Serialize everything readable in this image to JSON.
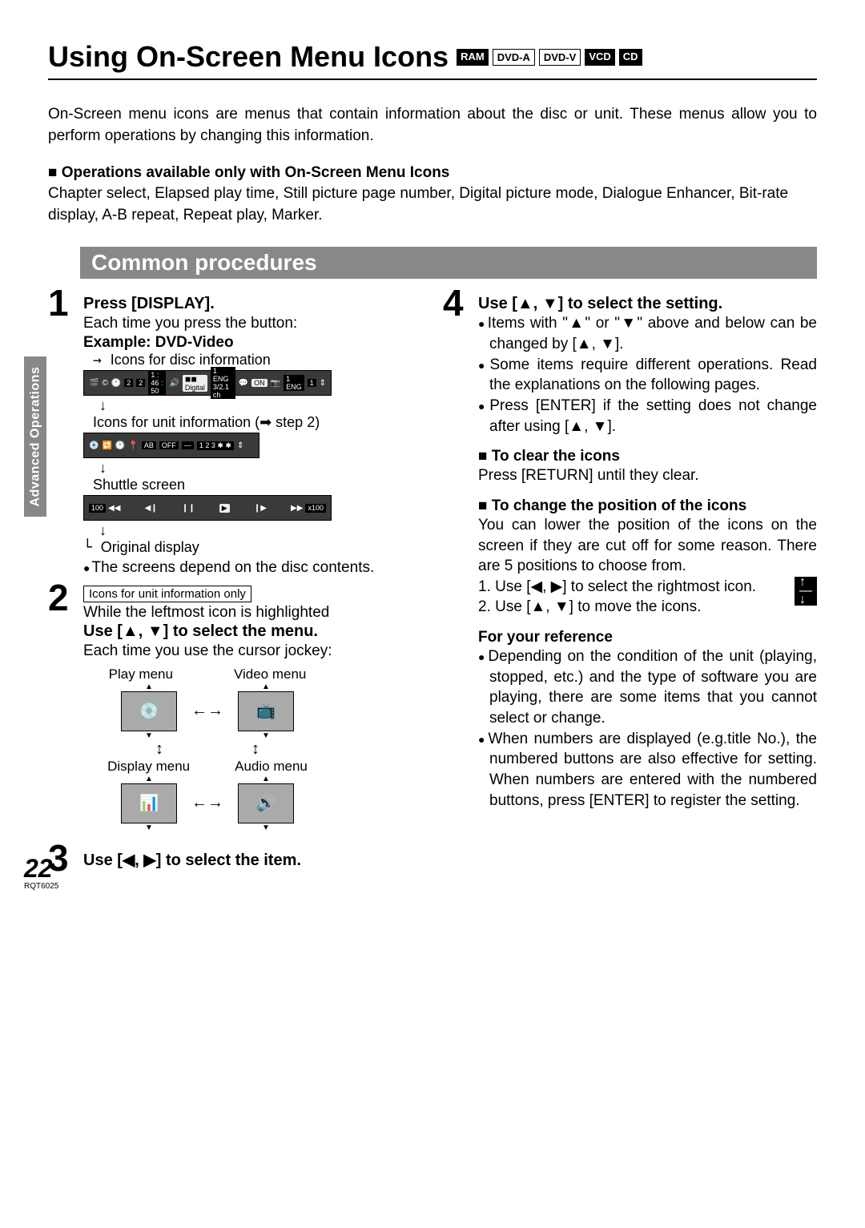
{
  "title": "Using On-Screen Menu Icons",
  "badges": [
    "RAM",
    "DVD-A",
    "DVD-V",
    "VCD",
    "CD"
  ],
  "sidetab": "Advanced Operations",
  "intro": "On-Screen menu icons are menus that contain information about the disc or unit. These menus allow you to perform operations by changing this information.",
  "ops_head": "Operations available only with On-Screen Menu Icons",
  "ops_list": "Chapter select, Elapsed play time, Still picture page number, Digital picture mode, Dialogue Enhancer, Bit-rate display, A-B repeat, Repeat play, Marker.",
  "section_bar": "Common procedures",
  "step1": {
    "num": "1",
    "title": "Press [DISPLAY].",
    "line1": "Each time you press the button:",
    "example": "Example:  DVD-Video",
    "l_disc": "Icons for disc information",
    "l_unit": "Icons for unit information (➡ step 2)",
    "l_shuttle": "Shuttle screen",
    "l_orig": "Original display",
    "bullet": "The screens depend on the disc contents.",
    "osd1": {
      "a": "2",
      "b": "2",
      "c": "1 : 46 : 50",
      "d": "Digital",
      "e": "1 ENG 3/2.1 ch",
      "f": "ON",
      "g": "1 ENG",
      "h": "1"
    },
    "osd2": {
      "a": "AB",
      "b": "OFF",
      "c": "---",
      "d": "1 2 3 ✱ ✱"
    },
    "osd3": {
      "a": "100",
      "b": "◀◀",
      "c": "◀❙",
      "d": "❙❙",
      "e": "▶",
      "f": "❙▶",
      "g": "▶▶",
      "h": "x100"
    }
  },
  "step2": {
    "num": "2",
    "boxnote": "Icons for unit information only",
    "line1": "While the leftmost icon is highlighted",
    "title": "Use [▲, ▼] to select the menu.",
    "line2": "Each time you use the cursor jockey:",
    "labels": {
      "play": "Play menu",
      "video": "Video menu",
      "display": "Display menu",
      "audio": "Audio menu"
    }
  },
  "step3": {
    "num": "3",
    "title": "Use [◀, ▶] to select the item."
  },
  "step4": {
    "num": "4",
    "title": "Use [▲, ▼] to select the setting.",
    "b1": "Items with \"▲\" or \"▼\" above and below can be changed by [▲, ▼].",
    "b2": "Some items require different operations. Read the explanations on the following pages.",
    "b3": "Press [ENTER] if the setting does not change after using [▲, ▼].",
    "clear_h": "To clear the icons",
    "clear_t": "Press [RETURN] until they clear.",
    "pos_h": "To change the position of the icons",
    "pos_t": "You can lower the position of the icons on the screen if they are cut off for some reason. There are 5 positions to choose from.",
    "pos_1": "1.  Use [◀, ▶] to select the rightmost icon.",
    "pos_2": "2.  Use [▲, ▼] to move the icons.",
    "ref_h": "For your reference",
    "ref_b1": "Depending on the condition of the unit (playing, stopped, etc.) and the type of software you are playing, there are some items that you cannot select or change.",
    "ref_b2": "When numbers are displayed (e.g.title No.), the numbered buttons are also effective for setting. When numbers are entered with the numbered buttons, press [ENTER] to register the setting."
  },
  "page_num": "22",
  "doc_id": "RQT6025"
}
